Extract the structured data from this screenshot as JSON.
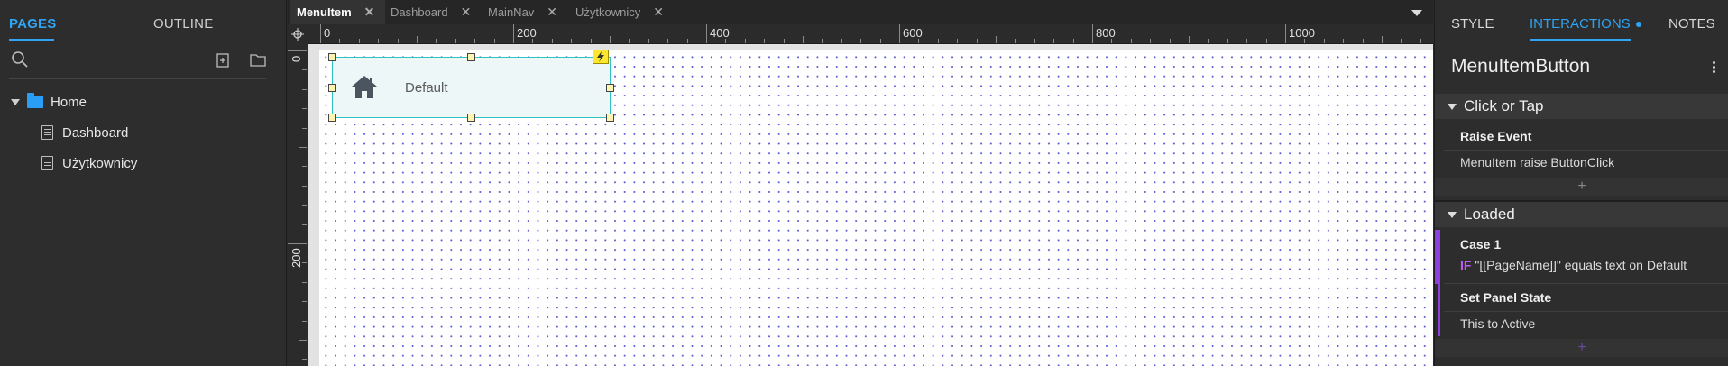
{
  "left_panel": {
    "tabs": {
      "pages": "PAGES",
      "outline": "OUTLINE"
    },
    "tree": {
      "root": "Home",
      "children": [
        "Dashboard",
        "Użytkownicy"
      ]
    },
    "icons": [
      "search-icon",
      "add-page-icon",
      "add-folder-icon",
      "folder-icon",
      "page-icon"
    ]
  },
  "doc_tabs": [
    "MenuItem",
    "Dashboard",
    "MainNav",
    "Użytkownicy"
  ],
  "ruler": {
    "h_labels": [
      "0",
      "200",
      "400",
      "600",
      "800",
      "1000"
    ],
    "v_labels": [
      "0",
      "200"
    ]
  },
  "canvas": {
    "widget_label": "Default",
    "widget_icon": "home-icon",
    "interaction_badge": "lightning-icon"
  },
  "right_panel": {
    "tabs": {
      "style": "STYLE",
      "interactions": "INTERACTIONS",
      "notes": "NOTES"
    },
    "widget_name": "MenuItemButton",
    "sections": {
      "click": {
        "title": "Click or Tap",
        "action_title": "Raise Event",
        "action_text": "MenuItem raise ButtonClick",
        "add": "+"
      },
      "loaded": {
        "title": "Loaded",
        "case_title": "Case 1",
        "condition_kw": "IF",
        "condition": "\"[[PageName]]\" equals text on Default",
        "action_title": "Set Panel State",
        "action_text": "This to Active",
        "add": "+"
      }
    }
  },
  "colors": {
    "accent": "#2fa4f2",
    "case": "#8e3fe0",
    "widget_border": "#2dc3c3",
    "badge": "#ffe62e"
  }
}
